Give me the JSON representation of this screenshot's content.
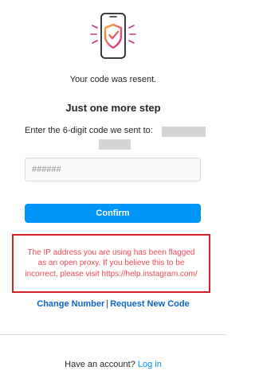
{
  "header": {
    "icon": "phone-shield-icon",
    "resent_message": "Your code was resent."
  },
  "verify": {
    "title": "Just one more step",
    "instruction": "Enter the 6-digit code we sent to:",
    "code_placeholder": "######",
    "confirm_label": "Confirm"
  },
  "error": {
    "message": "The IP address you are using has been flagged as an open proxy. If you believe this to be incorrect, please visit https://help.instagram.com/",
    "color": "#ed4956",
    "highlight_border": "#d21f2b"
  },
  "actions": {
    "change_number": "Change Number",
    "separator": "|",
    "request_new_code": "Request New Code"
  },
  "footer": {
    "prompt": "Have an account?",
    "login_label": "Log in"
  },
  "colors": {
    "accent": "#0095f6",
    "icon_gradient_start": "#f9a825",
    "icon_gradient_end": "#d6249f"
  }
}
